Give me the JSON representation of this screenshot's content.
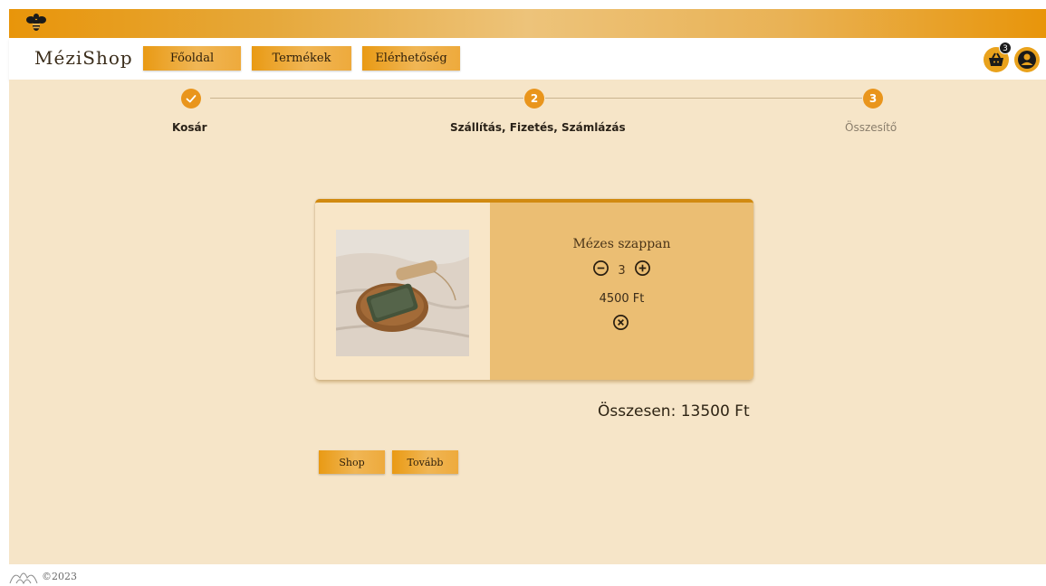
{
  "header": {
    "brand": "MéziShop",
    "nav": {
      "home": "Főoldal",
      "products": "Termékek",
      "contact": "Elérhetőség"
    },
    "cart_count": "3"
  },
  "stepper": {
    "steps": [
      {
        "number": "1",
        "label": "Kosár",
        "state": "done"
      },
      {
        "number": "2",
        "label": "Szállítás, Fizetés, Számlázás",
        "state": "active"
      },
      {
        "number": "3",
        "label": "Összesítő",
        "state": "pending"
      }
    ]
  },
  "cart": {
    "items": [
      {
        "name": "Mézes szappan",
        "quantity": "3",
        "price": "4500 Ft"
      }
    ],
    "total": "Összesen: 13500 Ft"
  },
  "actions": {
    "shop": "Shop",
    "next": "Tovább"
  },
  "footer": {
    "copyright": "©2023"
  },
  "colors": {
    "accent": "#e9951c",
    "background": "#f6e5c8",
    "card_panel": "#ebbe73"
  },
  "icons": {
    "logo": "bee-icon",
    "cart": "basket-icon",
    "user": "user-circle-icon",
    "done": "check-icon",
    "decrease": "minus-circle-icon",
    "increase": "plus-circle-icon",
    "remove": "close-circle-icon",
    "footer": "flower-logo-icon"
  }
}
